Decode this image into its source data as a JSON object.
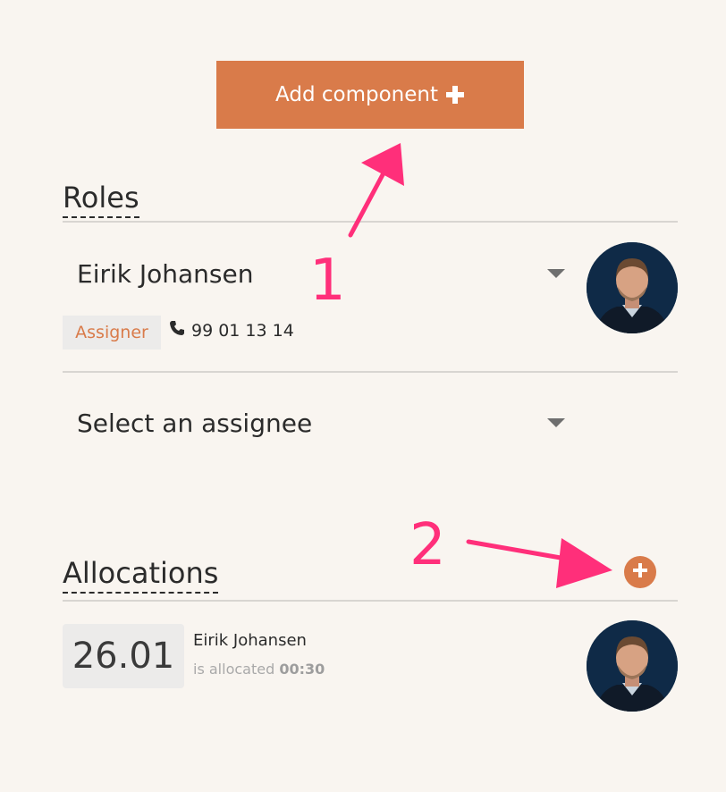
{
  "toolbar": {
    "add_component_label": "Add component"
  },
  "roles": {
    "title": "Roles",
    "assignee": {
      "name": "Eirik Johansen",
      "role_badge": "Assigner",
      "phone": "99 01 13 14"
    },
    "empty_select_placeholder": "Select an assignee"
  },
  "allocations": {
    "title": "Allocations",
    "items": [
      {
        "date": "26.01",
        "name": "Eirik Johansen",
        "desc_prefix": "is allocated",
        "duration": "00:30"
      }
    ]
  },
  "annotations": {
    "step1": "1",
    "step2": "2"
  },
  "colors": {
    "accent": "#d97b4a",
    "annotation": "#ff2f7a",
    "background": "#f9f5f0",
    "badge_bg": "#ecebea"
  },
  "icons": {
    "add_button_icon": "plus-icon",
    "phone": "phone-icon",
    "dropdown": "caret-down-icon",
    "allocation_add": "plus-circle-icon",
    "avatar": "avatar"
  }
}
